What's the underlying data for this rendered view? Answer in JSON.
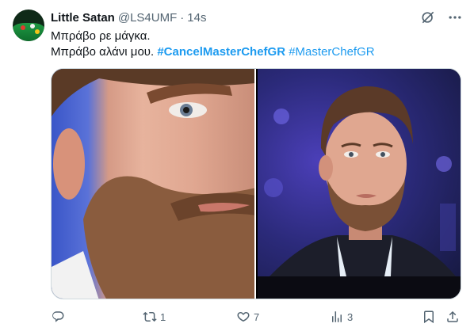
{
  "tweet": {
    "author_name": "Little Satan",
    "handle": "@LS4UMF",
    "separator": "·",
    "time": "14s",
    "line1": "Μπράβο ρε μάγκα.",
    "line2_text": "Μπράβο αλάνι μου. ",
    "hashtag1": "#CancelMasterChefGR",
    "hashtag2": "#MasterChefGR"
  },
  "icons": {
    "grok": "grok-icon",
    "more": "more-icon",
    "reply": "reply-icon",
    "retweet": "retweet-icon",
    "like": "like-icon",
    "views": "views-icon",
    "bookmark": "bookmark-icon",
    "share": "share-icon"
  },
  "actions": {
    "reply_count": "",
    "retweet_count": "1",
    "like_count": "7",
    "views_count": "3"
  },
  "colors": {
    "text": "#0f1419",
    "secondary": "#536471",
    "link": "#1d9bf0"
  }
}
